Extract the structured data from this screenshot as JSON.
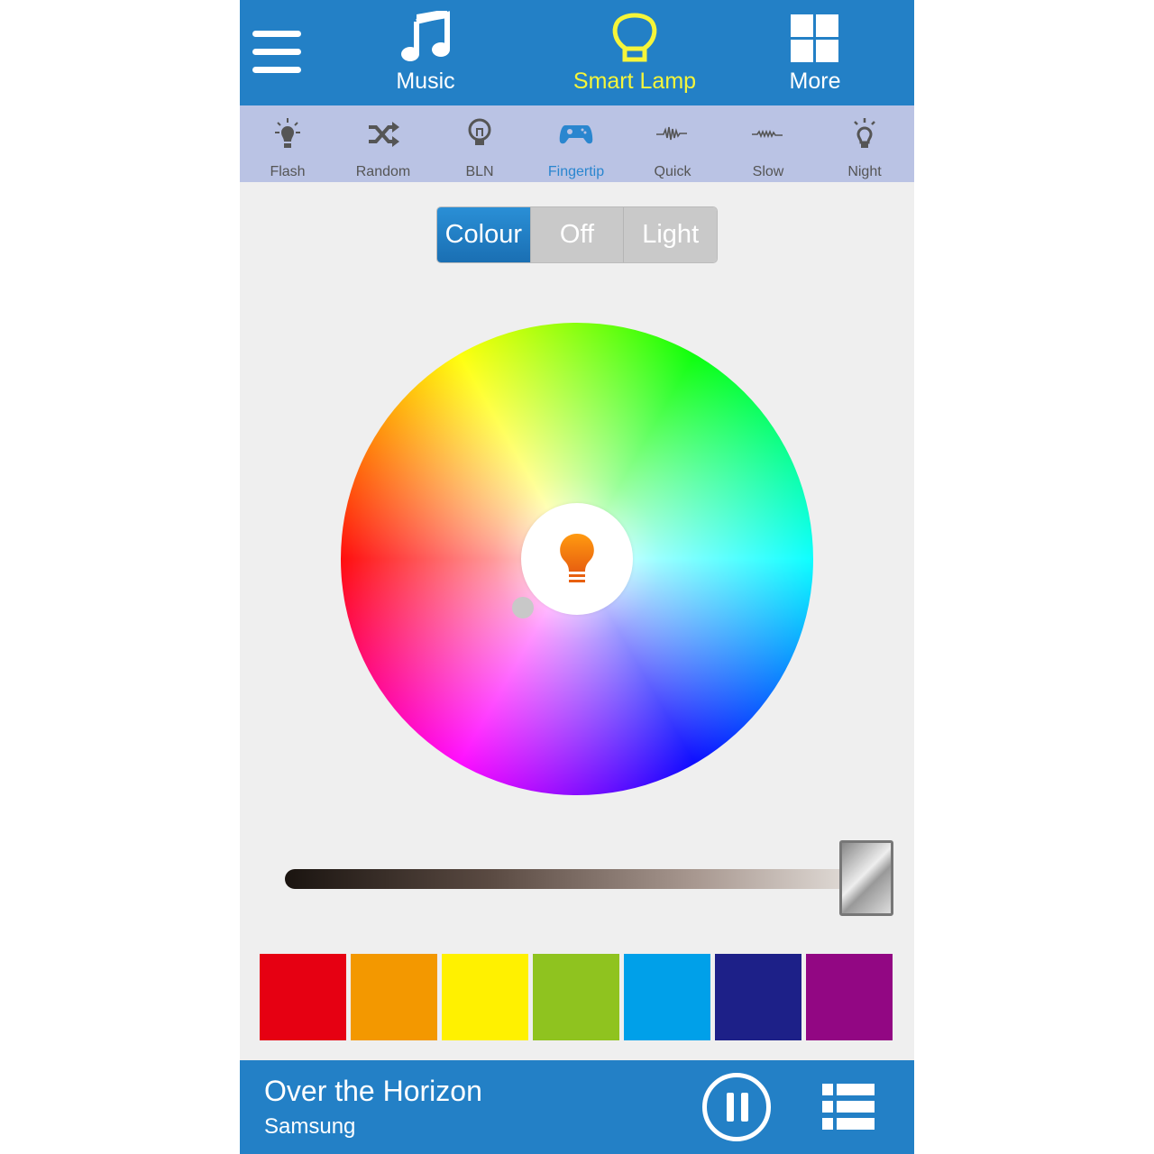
{
  "topbar": {
    "tabs": [
      {
        "label": "Music",
        "icon": "music-note-icon"
      },
      {
        "label": "Smart Lamp",
        "icon": "lamp-icon",
        "active": true
      },
      {
        "label": "More",
        "icon": "grid-icon"
      }
    ],
    "active_color": "#f5f53a"
  },
  "modes": [
    {
      "label": "Flash",
      "icon": "flash-bulb-icon"
    },
    {
      "label": "Random",
      "icon": "shuffle-icon"
    },
    {
      "label": "BLN",
      "icon": "bulb-icon"
    },
    {
      "label": "Fingertip",
      "icon": "gamepad-icon",
      "active": true
    },
    {
      "label": "Quick",
      "icon": "quick-wave-icon"
    },
    {
      "label": "Slow",
      "icon": "slow-wave-icon"
    },
    {
      "label": "Night",
      "icon": "night-bulb-icon"
    }
  ],
  "segment": {
    "options": [
      "Colour",
      "Off",
      "Light"
    ],
    "selected": "Colour"
  },
  "brightness": {
    "value_percent": 100
  },
  "swatches": [
    "#e60012",
    "#f39800",
    "#fff100",
    "#8fc31f",
    "#00a0e9",
    "#1d2088",
    "#920783"
  ],
  "player": {
    "title": "Over the Horizon",
    "artist": "Samsung",
    "state": "playing"
  }
}
